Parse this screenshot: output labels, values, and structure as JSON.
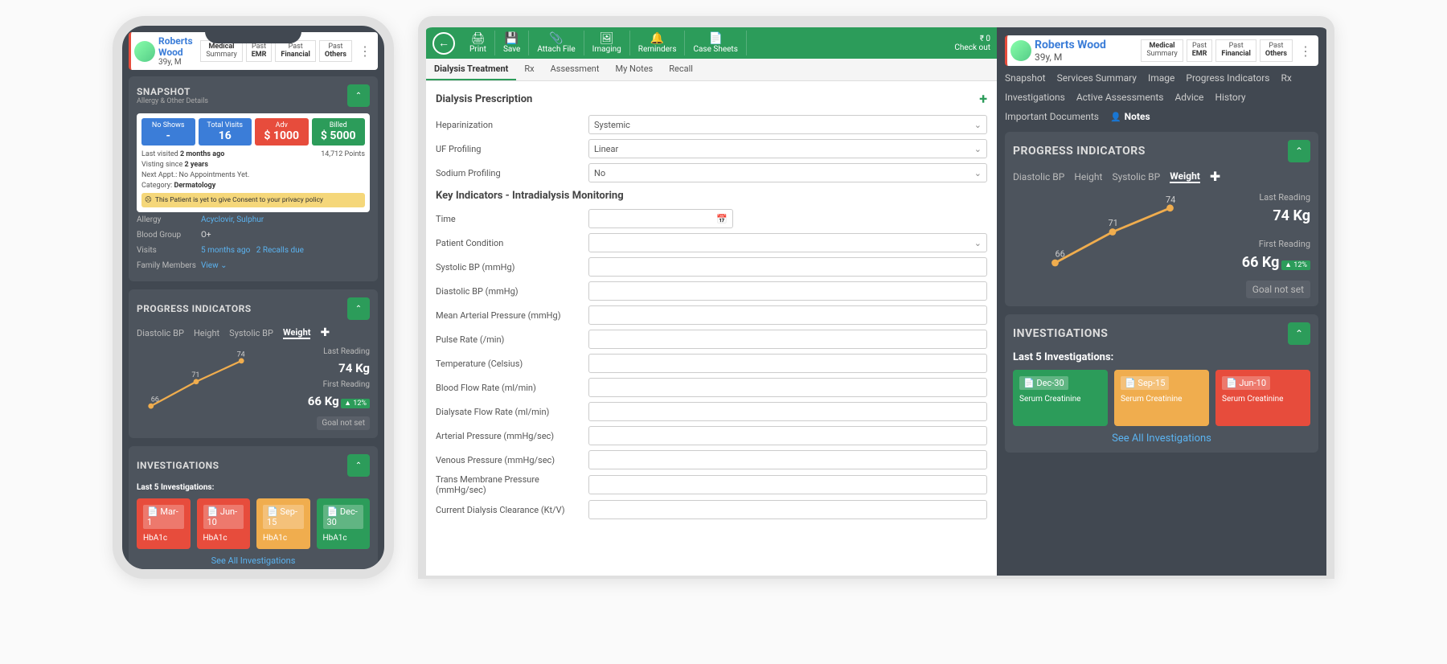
{
  "patient": {
    "name": "Roberts Wood",
    "sub": "39y, M"
  },
  "hdrBtns": {
    "medical": "Medical",
    "summary": "Summary",
    "past": "Past",
    "emr": "EMR",
    "financial": "Financial",
    "others": "Others"
  },
  "phone": {
    "snapshot": {
      "title": "SNAPSHOT",
      "sub": "Allergy & Other Details"
    },
    "stats": {
      "noshowsLbl": "No Shows",
      "noshows": "-",
      "visitsLbl": "Total Visits",
      "visits": "16",
      "advLbl": "Adv",
      "adv": "$ 1000",
      "billedLbl": "Billed",
      "billed": "$ 5000"
    },
    "lines": {
      "lastVisited": "Last visited",
      "lastVisitedVal": "2 months ago",
      "points": "14,712 Points",
      "visitingSince": "Visting since",
      "visitingVal": "2 years",
      "nextAppt": "Next Appt.: No Appointments Yet.",
      "category": "Category:",
      "categoryVal": "Dermatology",
      "warn": "This Patient is yet to give Consent to your privacy policy"
    },
    "kv": {
      "allergyK": "Allergy",
      "allergyV": "Acyclovir, Sulphur",
      "bgK": "Blood Group",
      "bgV": "O+",
      "visitsK": "Visits",
      "visitsV": "5 months ago",
      "recalls": "2 Recalls due",
      "famK": "Family Members",
      "famV": "View"
    },
    "inv": {
      "title": "INVESTIGATIONS",
      "sub": "Last 5 Investigations:",
      "see": "See All Investigations",
      "items": [
        {
          "date": "Mar-1",
          "name": "HbA1c",
          "color": "inv-red"
        },
        {
          "date": "Jun-10",
          "name": "HbA1c",
          "color": "inv-red"
        },
        {
          "date": "Sep-15",
          "name": "HbA1c",
          "color": "inv-yellow"
        },
        {
          "date": "Dec-30",
          "name": "HbA1c",
          "color": "inv-green"
        }
      ]
    }
  },
  "toolbar": {
    "print": "Print",
    "save": "Save",
    "attach": "Attach File",
    "imaging": "Imaging",
    "reminders": "Reminders",
    "casesheets": "Case Sheets",
    "amount": "₹ 0",
    "checkout": "Check out"
  },
  "subtabs": {
    "dt": "Dialysis Treatment",
    "rx": "Rx",
    "assessment": "Assessment",
    "mynotes": "My Notes",
    "recall": "Recall"
  },
  "form": {
    "sec1": "Dialysis Prescription",
    "hep": "Heparinization",
    "hepVal": "Systemic",
    "uf": "UF Profiling",
    "ufVal": "Linear",
    "sodium": "Sodium Profiling",
    "sodiumVal": "No",
    "sec2": "Key Indicators - Intradialysis Monitoring",
    "time": "Time",
    "pc": "Patient Condition",
    "sbp": "Systolic BP (mmHg)",
    "dbp": "Diastolic BP (mmHg)",
    "map": "Mean Arterial Pressure (mmHg)",
    "pulse": "Pulse Rate (/min)",
    "temp": "Temperature (Celsius)",
    "bfr": "Blood Flow Rate (ml/min)",
    "dfr": "Dialysate Flow Rate (ml/min)",
    "ap": "Arterial Pressure (mmHg/sec)",
    "vp": "Venous Pressure (mmHg/sec)",
    "tmp": "Trans Membrane Pressure (mmHg/sec)",
    "cdc": "Current Dialysis Clearance (Kt/V)"
  },
  "sideNav": {
    "snapshot": "Snapshot",
    "services": "Services Summary",
    "image": "Image",
    "progress": "Progress Indicators",
    "rx": "Rx",
    "inv": "Investigations",
    "active": "Active Assessments",
    "advice": "Advice",
    "history": "History",
    "docs": "Important Documents",
    "notes": "Notes"
  },
  "pi": {
    "title": "PROGRESS INDICATORS",
    "tabs": {
      "dbp": "Diastolic BP",
      "height": "Height",
      "sbp": "Systolic BP",
      "weight": "Weight"
    },
    "lastLbl": "Last Reading",
    "lastVal": "74 Kg",
    "firstLbl": "First Reading",
    "firstVal": "66 Kg",
    "pct": "12%",
    "goal": "Goal not set"
  },
  "inv": {
    "title": "INVESTIGATIONS",
    "sub": "Last 5 Investigations:",
    "see": "See All Investigations",
    "items": [
      {
        "date": "Dec-30",
        "name": "Serum Creatinine",
        "color": "inv-green"
      },
      {
        "date": "Sep-15",
        "name": "Serum Creatinine",
        "color": "inv-yellow"
      },
      {
        "date": "Jun-10",
        "name": "Serum Creatinine",
        "color": "inv-red"
      }
    ]
  },
  "chart_data": {
    "type": "line",
    "title": "Weight",
    "ylabel": "Kg",
    "x": [
      1,
      2,
      3
    ],
    "values": [
      66,
      71,
      74
    ],
    "ylim": [
      60,
      80
    ]
  }
}
